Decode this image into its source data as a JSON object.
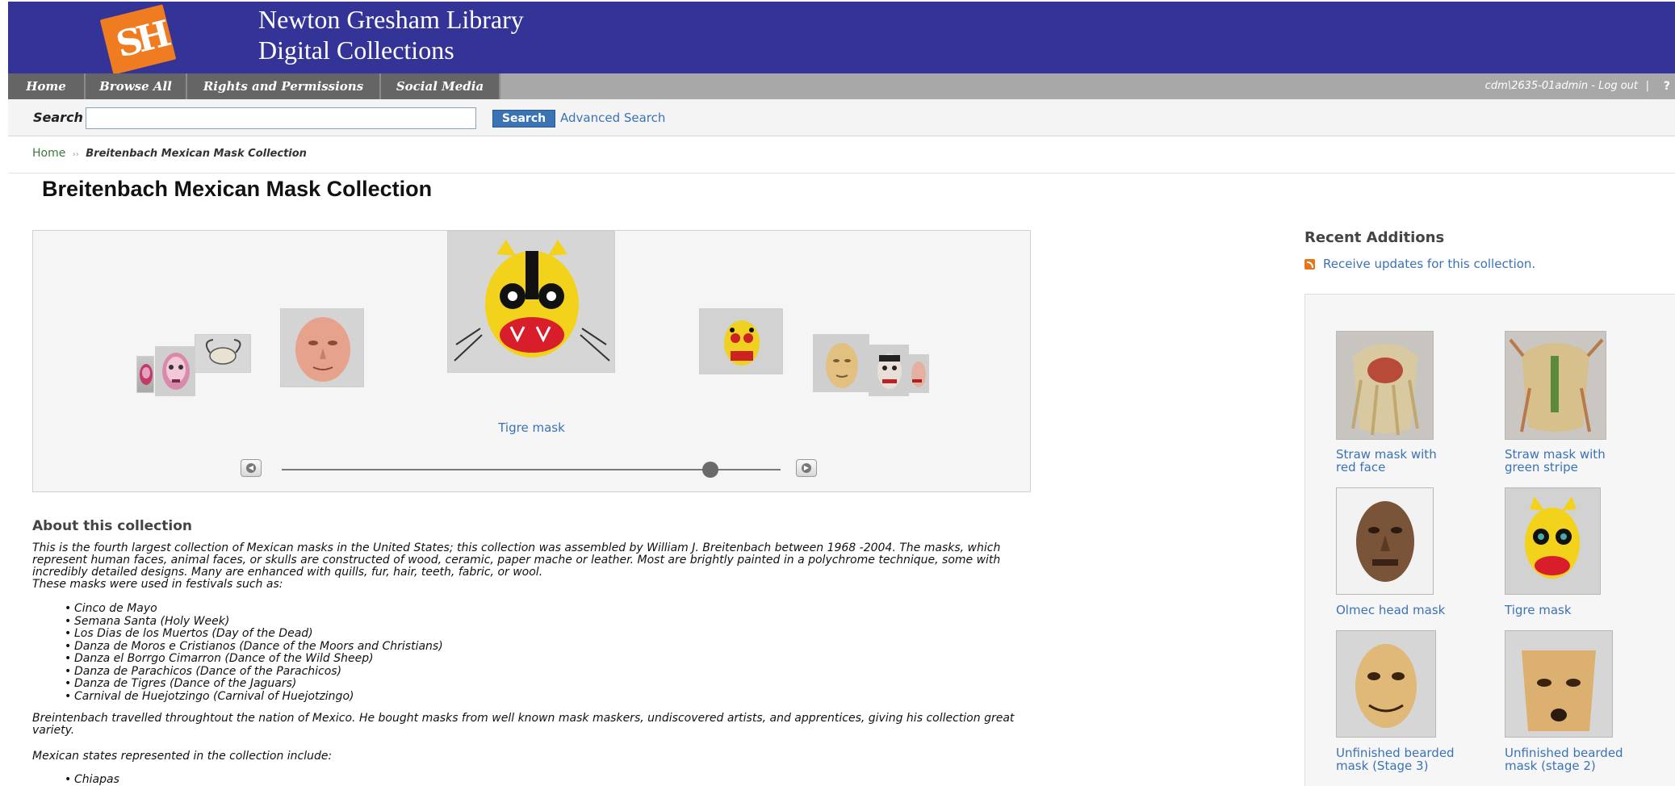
{
  "header": {
    "logo_alt": "SH",
    "title_line1": "Newton Gresham Library",
    "title_line2": "Digital Collections"
  },
  "nav": {
    "items": [
      {
        "label": "Home"
      },
      {
        "label": "Browse All"
      },
      {
        "label": "Rights and Permissions"
      },
      {
        "label": "Social Media"
      }
    ],
    "user_text": "cdm\\2635-01admin - Log out",
    "separator": "|",
    "help": "?"
  },
  "search": {
    "label": "Search",
    "input_value": "",
    "button_label": "Search",
    "advanced_link": "Advanced Search"
  },
  "breadcrumb": {
    "home": "Home",
    "separator": "››",
    "current": "Breitenbach Mexican Mask Collection"
  },
  "page_title": "Breitenbach Mexican Mask Collection",
  "carousel": {
    "caption": "Tigre mask",
    "slider_position": 0.86,
    "prev_icon": "left-arrow-circle-icon",
    "next_icon": "right-arrow-circle-icon",
    "accent": "#3a72b8"
  },
  "about": {
    "title": "About this collection",
    "intro": "This is the fourth largest collection of Mexican masks in the United States; this collection was assembled by William J. Breitenbach between 1968 -2004. The masks, which represent human faces, animal faces, or skulls are constructed of wood, ceramic, paper mache or leather. Most are brightly painted in a polychrome technique, some with incredibly detailed designs. Many are enhanced with quills, fur, hair, teeth, fabric, or wool.",
    "festivals_intro": "These masks were used in festivals such as:",
    "festivals": [
      "Cinco de Mayo",
      "Semana Santa (Holy Week)",
      "Los Dias de los Muertos (Day of the Dead)",
      "Danza de Moros e Cristianos (Dance of the Moors and Christians)",
      "Danza el Borrgo Cimarron (Dance of the Wild Sheep)",
      "Danza de Parachicos (Dance of the Parachicos)",
      "Danza de Tigres (Dance of the Jaguars)",
      "Carnival de Huejotzingo (Carnival of Huejotzingo)"
    ],
    "travel": "Breintenbach travelled  throughtout the nation of Mexico. He bought masks from well known mask maskers, undiscovered artists, and apprentices, giving his collection great variety.",
    "states_intro": "Mexican states represented in the collection include:",
    "states": [
      "Chiapas"
    ]
  },
  "recent": {
    "title": "Recent Additions",
    "rss_link": "Receive updates for this collection.",
    "rss_icon": "rss-icon",
    "items": [
      {
        "caption": "Straw mask with red face"
      },
      {
        "caption": "Straw mask with green stripe"
      },
      {
        "caption": "Olmec head mask"
      },
      {
        "caption": "Tigre mask"
      },
      {
        "caption": "Unfinished bearded mask (Stage 3)"
      },
      {
        "caption": "Unfinished bearded mask (stage 2)"
      }
    ]
  },
  "colors": {
    "header_bg": "#333398",
    "nav_item_bg": "#656565",
    "nav_bar_bg": "#a8a8a8",
    "logo_orange": "#f07c22",
    "link_blue": "#3a72b8",
    "search_button": "#3b73b5"
  }
}
